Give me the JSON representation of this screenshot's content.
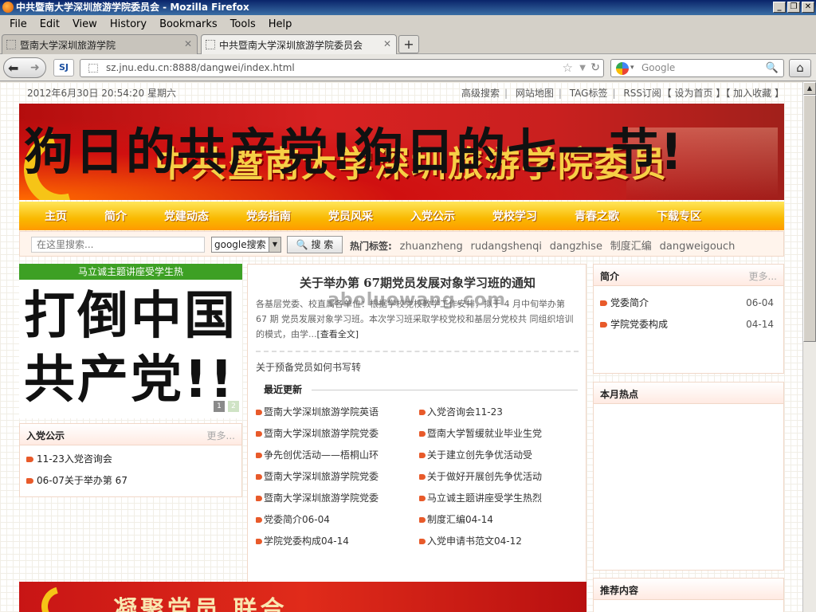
{
  "window": {
    "title": "中共暨南大学深圳旅游学院委员会 - Mozilla Firefox",
    "buttons": [
      "_",
      "❐",
      "✕"
    ]
  },
  "menubar": {
    "items": [
      "File",
      "Edit",
      "View",
      "History",
      "Bookmarks",
      "Tools",
      "Help"
    ]
  },
  "tabs": [
    {
      "label": "暨南大学深圳旅游学院",
      "active": false
    },
    {
      "label": "中共暨南大学深圳旅游学院委员会",
      "active": true
    }
  ],
  "navbar": {
    "url": "sz.jnu.edu.cn:8888/dangwei/index.html",
    "site_icon_text": "SJ",
    "search_placeholder": "Google"
  },
  "page": {
    "datetime": "2012年6月30日 20:54:20 星期六",
    "top_links": [
      "高级搜索",
      "网站地图",
      "TAG标签",
      "RSS订阅"
    ],
    "fav_links": "【 设为首页 】【 加入收藏 】",
    "banner_title": "中共暨南大学深圳旅游学院委员",
    "banner_overlay": "狗日的共产党!狗日的七一节!",
    "nav": [
      "主页",
      "简介",
      "党建动态",
      "党务指南",
      "党员风采",
      "入党公示",
      "党校学习",
      "青春之歌",
      "下载专区"
    ],
    "search": {
      "placeholder": "在这里搜索...",
      "engine": "google搜索",
      "button": "搜 索",
      "hot_label": "热门标签:",
      "hot_tags": [
        "zhuanzheng",
        "rudangshenqi",
        "dangzhise",
        "制度汇编",
        "dangweigouch"
      ]
    },
    "slideshow": {
      "caption": "马立诚主题讲座受学生热",
      "text_line1": "打倒中国",
      "text_line2": "共产党!!",
      "dots": [
        "1",
        "2"
      ]
    },
    "rudang_box": {
      "title": "入党公示",
      "more": "更多...",
      "items": [
        "11-23入党咨询会",
        "06-07关于举办第 67"
      ]
    },
    "center": {
      "headline": "关于举办第 67期党员发展对象学习班的通知",
      "summary": "各基层党委、校直属各单位：根据学校党校教学工作安排，拟于 4 月中旬举办第 67 期 党员发展对象学习班。本次学习班采取学校党校和基层分党校共 同组织培训的模式，由学...",
      "read_more": "[查看全文]",
      "watermark": "aboluowang.com",
      "sub_link": "关于预备党员如何书写转",
      "recent_title": "最近更新",
      "recent_left": [
        "暨南大学深圳旅游学院英语",
        "暨南大学深圳旅游学院党委",
        "争先创优活动——梧桐山环",
        "暨南大学深圳旅游学院党委",
        "暨南大学深圳旅游学院党委",
        "党委简介06-04",
        "学院党委构成04-14"
      ],
      "recent_right": [
        "入党咨询会11-23",
        "暨南大学暂缓就业毕业生党",
        "关于建立创先争优活动受",
        "关于做好开展创先争优活动",
        "马立诚主题讲座受学生热烈",
        "制度汇编04-14",
        "入党申请书范文04-12"
      ]
    },
    "right": {
      "intro": {
        "title": "简介",
        "more": "更多...",
        "items": [
          {
            "label": "党委简介",
            "date": "06-04"
          },
          {
            "label": "学院党委构成",
            "date": "04-14"
          }
        ]
      },
      "hot_title": "本月热点",
      "recommend_title": "推荐内容"
    },
    "bottom_banner_text": "凝聚党员 联合"
  },
  "colors": {
    "nav_gradient_top": "#ffe65a",
    "nav_gradient_bottom": "#ff9a00",
    "banner_red": "#c9201f",
    "slideshow_caption": "#3da024",
    "bullet": "#e85a2a"
  }
}
